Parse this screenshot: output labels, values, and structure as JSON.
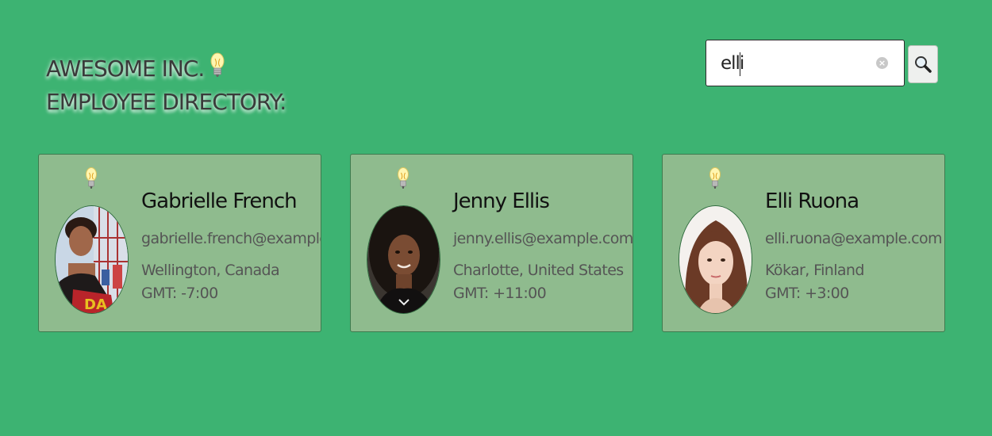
{
  "header": {
    "line1": "AWESOME INC.",
    "line2": "EMPLOYEE DIRECTORY:",
    "icon": "lightbulb-icon"
  },
  "search": {
    "value": "elli",
    "clear_icon": "clear-icon",
    "button_icon": "magnifier-icon"
  },
  "colors": {
    "background": "#3db372",
    "card": "#8fbb8e",
    "card_border": "#3e7a4e"
  },
  "employees": [
    {
      "name": "Gabrielle French",
      "email": "gabrielle.french@example.com",
      "location": "Wellington, Canada",
      "timezone": "GMT: -7:00"
    },
    {
      "name": "Jenny Ellis",
      "email": "jenny.ellis@example.com",
      "location": "Charlotte, United States",
      "timezone": "GMT: +11:00"
    },
    {
      "name": "Elli Ruona",
      "email": "elli.ruona@example.com",
      "location": "Kökar, Finland",
      "timezone": "GMT: +3:00"
    }
  ]
}
